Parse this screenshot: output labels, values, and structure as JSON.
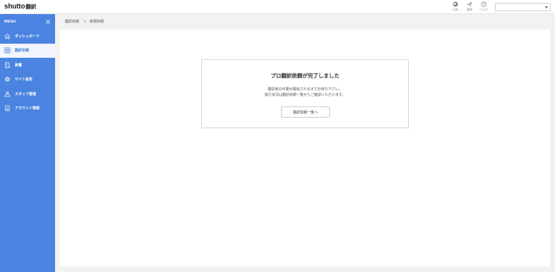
{
  "header": {
    "logo_en": "shutto",
    "logo_ja": "翻訳",
    "icons": [
      {
        "name": "language-icon",
        "label": "日本"
      },
      {
        "name": "notification-icon",
        "label": "通知"
      },
      {
        "name": "help-icon",
        "label": "ヘルプ"
      }
    ],
    "select_value": ""
  },
  "sidebar": {
    "title": "MENU",
    "items": [
      {
        "label": "ダッシュボード",
        "icon": "home-icon",
        "active": false
      },
      {
        "label": "翻訳依頼",
        "icon": "grid-icon",
        "active": true
      },
      {
        "label": "辞書",
        "icon": "book-icon",
        "active": false
      },
      {
        "label": "サイト設定",
        "icon": "gear-icon",
        "active": false
      },
      {
        "label": "スタッフ管理",
        "icon": "staff-icon",
        "active": false
      },
      {
        "label": "アカウント情報",
        "icon": "document-icon",
        "active": false
      }
    ]
  },
  "breadcrumb": {
    "items": [
      "翻訳依頼",
      "新規依頼"
    ]
  },
  "card": {
    "title": "プロ翻訳依頼が完了しました",
    "message_line1": "翻訳者の作業が開始されるまでお待ち下さい。",
    "message_line2": "進行状況は翻訳依頼一覧からご確認いただけます。",
    "button_label": "翻訳依頼一覧へ"
  },
  "colors": {
    "accent": "#4a84e0",
    "background": "#f2f2f2"
  }
}
